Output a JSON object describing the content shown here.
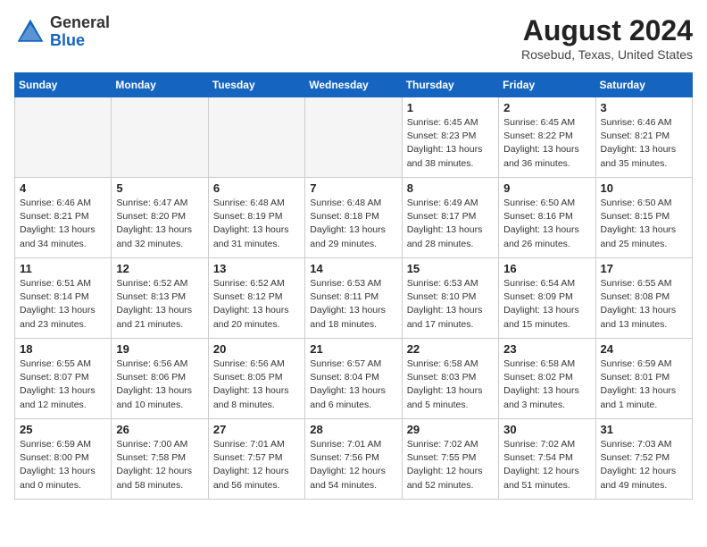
{
  "header": {
    "logo_general": "General",
    "logo_blue": "Blue",
    "month_year": "August 2024",
    "location": "Rosebud, Texas, United States"
  },
  "weekdays": [
    "Sunday",
    "Monday",
    "Tuesday",
    "Wednesday",
    "Thursday",
    "Friday",
    "Saturday"
  ],
  "weeks": [
    [
      {
        "day": "",
        "info": ""
      },
      {
        "day": "",
        "info": ""
      },
      {
        "day": "",
        "info": ""
      },
      {
        "day": "",
        "info": ""
      },
      {
        "day": "1",
        "info": "Sunrise: 6:45 AM\nSunset: 8:23 PM\nDaylight: 13 hours\nand 38 minutes."
      },
      {
        "day": "2",
        "info": "Sunrise: 6:45 AM\nSunset: 8:22 PM\nDaylight: 13 hours\nand 36 minutes."
      },
      {
        "day": "3",
        "info": "Sunrise: 6:46 AM\nSunset: 8:21 PM\nDaylight: 13 hours\nand 35 minutes."
      }
    ],
    [
      {
        "day": "4",
        "info": "Sunrise: 6:46 AM\nSunset: 8:21 PM\nDaylight: 13 hours\nand 34 minutes."
      },
      {
        "day": "5",
        "info": "Sunrise: 6:47 AM\nSunset: 8:20 PM\nDaylight: 13 hours\nand 32 minutes."
      },
      {
        "day": "6",
        "info": "Sunrise: 6:48 AM\nSunset: 8:19 PM\nDaylight: 13 hours\nand 31 minutes."
      },
      {
        "day": "7",
        "info": "Sunrise: 6:48 AM\nSunset: 8:18 PM\nDaylight: 13 hours\nand 29 minutes."
      },
      {
        "day": "8",
        "info": "Sunrise: 6:49 AM\nSunset: 8:17 PM\nDaylight: 13 hours\nand 28 minutes."
      },
      {
        "day": "9",
        "info": "Sunrise: 6:50 AM\nSunset: 8:16 PM\nDaylight: 13 hours\nand 26 minutes."
      },
      {
        "day": "10",
        "info": "Sunrise: 6:50 AM\nSunset: 8:15 PM\nDaylight: 13 hours\nand 25 minutes."
      }
    ],
    [
      {
        "day": "11",
        "info": "Sunrise: 6:51 AM\nSunset: 8:14 PM\nDaylight: 13 hours\nand 23 minutes."
      },
      {
        "day": "12",
        "info": "Sunrise: 6:52 AM\nSunset: 8:13 PM\nDaylight: 13 hours\nand 21 minutes."
      },
      {
        "day": "13",
        "info": "Sunrise: 6:52 AM\nSunset: 8:12 PM\nDaylight: 13 hours\nand 20 minutes."
      },
      {
        "day": "14",
        "info": "Sunrise: 6:53 AM\nSunset: 8:11 PM\nDaylight: 13 hours\nand 18 minutes."
      },
      {
        "day": "15",
        "info": "Sunrise: 6:53 AM\nSunset: 8:10 PM\nDaylight: 13 hours\nand 17 minutes."
      },
      {
        "day": "16",
        "info": "Sunrise: 6:54 AM\nSunset: 8:09 PM\nDaylight: 13 hours\nand 15 minutes."
      },
      {
        "day": "17",
        "info": "Sunrise: 6:55 AM\nSunset: 8:08 PM\nDaylight: 13 hours\nand 13 minutes."
      }
    ],
    [
      {
        "day": "18",
        "info": "Sunrise: 6:55 AM\nSunset: 8:07 PM\nDaylight: 13 hours\nand 12 minutes."
      },
      {
        "day": "19",
        "info": "Sunrise: 6:56 AM\nSunset: 8:06 PM\nDaylight: 13 hours\nand 10 minutes."
      },
      {
        "day": "20",
        "info": "Sunrise: 6:56 AM\nSunset: 8:05 PM\nDaylight: 13 hours\nand 8 minutes."
      },
      {
        "day": "21",
        "info": "Sunrise: 6:57 AM\nSunset: 8:04 PM\nDaylight: 13 hours\nand 6 minutes."
      },
      {
        "day": "22",
        "info": "Sunrise: 6:58 AM\nSunset: 8:03 PM\nDaylight: 13 hours\nand 5 minutes."
      },
      {
        "day": "23",
        "info": "Sunrise: 6:58 AM\nSunset: 8:02 PM\nDaylight: 13 hours\nand 3 minutes."
      },
      {
        "day": "24",
        "info": "Sunrise: 6:59 AM\nSunset: 8:01 PM\nDaylight: 13 hours\nand 1 minute."
      }
    ],
    [
      {
        "day": "25",
        "info": "Sunrise: 6:59 AM\nSunset: 8:00 PM\nDaylight: 13 hours\nand 0 minutes."
      },
      {
        "day": "26",
        "info": "Sunrise: 7:00 AM\nSunset: 7:58 PM\nDaylight: 12 hours\nand 58 minutes."
      },
      {
        "day": "27",
        "info": "Sunrise: 7:01 AM\nSunset: 7:57 PM\nDaylight: 12 hours\nand 56 minutes."
      },
      {
        "day": "28",
        "info": "Sunrise: 7:01 AM\nSunset: 7:56 PM\nDaylight: 12 hours\nand 54 minutes."
      },
      {
        "day": "29",
        "info": "Sunrise: 7:02 AM\nSunset: 7:55 PM\nDaylight: 12 hours\nand 52 minutes."
      },
      {
        "day": "30",
        "info": "Sunrise: 7:02 AM\nSunset: 7:54 PM\nDaylight: 12 hours\nand 51 minutes."
      },
      {
        "day": "31",
        "info": "Sunrise: 7:03 AM\nSunset: 7:52 PM\nDaylight: 12 hours\nand 49 minutes."
      }
    ]
  ]
}
